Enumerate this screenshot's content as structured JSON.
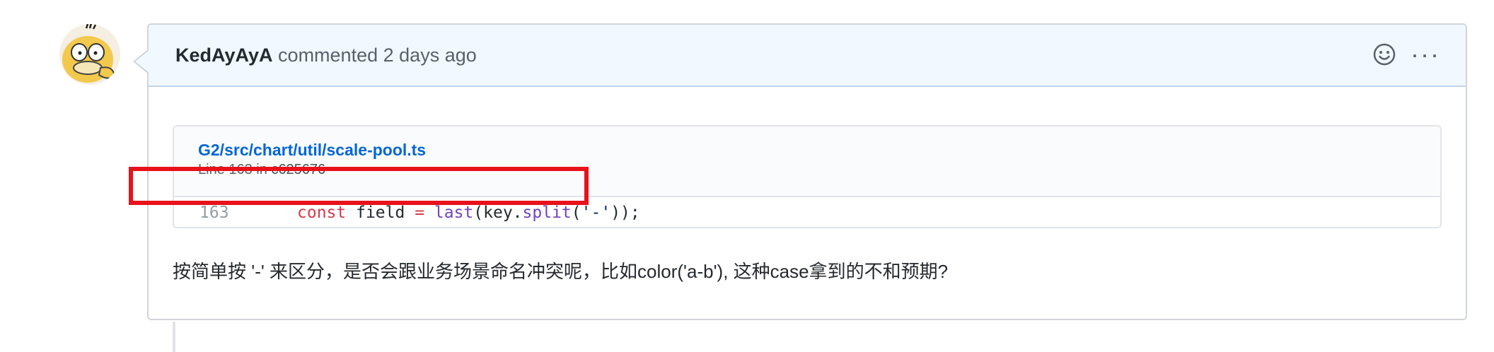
{
  "comment": {
    "author": "KedAyAyA",
    "action": "commented",
    "timestamp": "2 days ago",
    "header_icons": [
      "smiley-icon",
      "kebab-menu-icon"
    ],
    "more_label": "···",
    "body_text": "按简单按 '-' 来区分，是否会跟业务场景命名冲突呢，比如color('a-b'), 这种case拿到的不和预期?"
  },
  "snippet": {
    "file_path": "G2/src/chart/util/scale-pool.ts",
    "line_label": "Line 163 in",
    "commit": "c625676",
    "line_number": "163",
    "code": {
      "kw": "const",
      "var": " field ",
      "op": "=",
      "fn1": " last",
      "p1": "(key.",
      "fn2": "split",
      "p2": "(",
      "str": "'-'",
      "p3": "));"
    }
  },
  "colors": {
    "link": "#0366d6",
    "header_bg": "#f1f8ff",
    "highlight_border": "#e8121b",
    "keyword": "#d73a49",
    "function": "#6f42c1",
    "string": "#032f62"
  }
}
